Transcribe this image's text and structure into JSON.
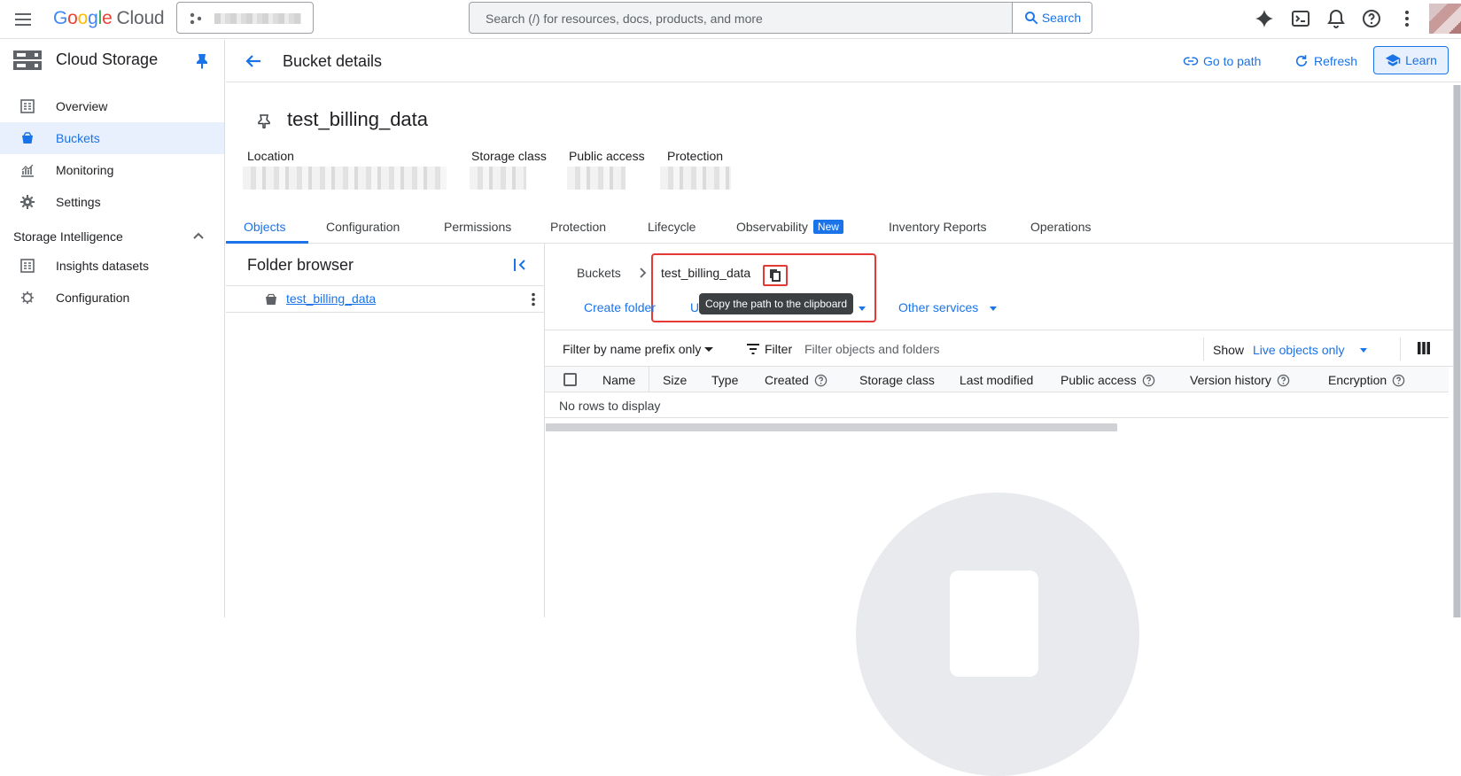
{
  "topbar": {
    "logo": {
      "g": "G",
      "o1": "o",
      "o2": "o",
      "g2": "g",
      "l": "l",
      "e": "e",
      "cloud": "Cloud"
    },
    "search_placeholder": "Search (/) for resources, docs, products, and more",
    "search_button": "Search",
    "icons": [
      "menu-icon",
      "gemini-sparkle-icon",
      "cloud-shell-icon",
      "notifications-icon",
      "help-icon",
      "more-vert-icon"
    ]
  },
  "leftnav": {
    "product_title": "Cloud Storage",
    "items": [
      {
        "label": "Overview",
        "icon": "overview-icon"
      },
      {
        "label": "Buckets",
        "icon": "bucket-icon",
        "active": true
      },
      {
        "label": "Monitoring",
        "icon": "monitoring-icon"
      },
      {
        "label": "Settings",
        "icon": "settings-icon"
      }
    ],
    "section": {
      "label": "Storage Intelligence",
      "expanded": true
    },
    "section_items": [
      {
        "label": "Insights datasets",
        "icon": "datasets-icon"
      },
      {
        "label": "Configuration",
        "icon": "configuration-icon"
      }
    ]
  },
  "header": {
    "title": "Bucket details",
    "go_to_path": "Go to path",
    "refresh": "Refresh",
    "learn": "Learn"
  },
  "bucket": {
    "name": "test_billing_data",
    "meta_labels": {
      "location": "Location",
      "storage_class": "Storage class",
      "public_access": "Public access",
      "protection": "Protection"
    }
  },
  "tabs": [
    {
      "label": "Objects",
      "active": true
    },
    {
      "label": "Configuration"
    },
    {
      "label": "Permissions"
    },
    {
      "label": "Protection"
    },
    {
      "label": "Lifecycle"
    },
    {
      "label": "Observability",
      "badge": "New"
    },
    {
      "label": "Inventory Reports"
    },
    {
      "label": "Operations"
    }
  ],
  "folder_browser": {
    "title": "Folder browser",
    "root": "test_billing_data"
  },
  "objects": {
    "breadcrumb_root": "Buckets",
    "breadcrumb_current": "test_billing_data",
    "tooltip": "Copy the path to the clipboard",
    "actions": {
      "create_folder": "Create folder",
      "upload_partial": "U",
      "other_services": "Other services"
    },
    "filter": {
      "prefix_mode": "Filter by name prefix only",
      "filter_label": "Filter",
      "placeholder": "Filter objects and folders",
      "show_label": "Show",
      "show_value": "Live objects only"
    },
    "columns": [
      "Name",
      "Size",
      "Type",
      "Created",
      "Storage class",
      "Last modified",
      "Public access",
      "Version history",
      "Encryption"
    ],
    "empty_message": "No rows to display"
  },
  "colors": {
    "accent": "#1a73e8",
    "highlight": "#e53935",
    "active_bg": "#e8f0fe"
  }
}
